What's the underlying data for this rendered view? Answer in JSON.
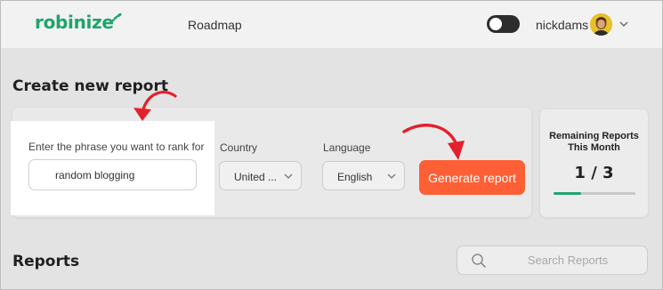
{
  "header": {
    "logo_text": "robinize",
    "nav": {
      "roadmap": "Roadmap"
    },
    "theme_toggle": {
      "state": "off"
    },
    "user": {
      "name": "nickdams"
    }
  },
  "create_report": {
    "title": "Create new report",
    "phrase": {
      "label": "Enter the phrase you want to rank for",
      "value": "random blogging"
    },
    "country": {
      "label": "Country",
      "selected": "United ..."
    },
    "language": {
      "label": "Language",
      "selected": "English"
    },
    "generate_label": "Generate report"
  },
  "remaining": {
    "title": "Remaining Reports This Month",
    "count": "1 / 3",
    "used": 1,
    "total": 3
  },
  "reports": {
    "title": "Reports",
    "search_placeholder": "Search Reports"
  },
  "colors": {
    "brand_green": "#1fa46d",
    "accent_orange": "#ff5f35",
    "annotation_red": "#e3202b"
  },
  "icons": {
    "logo": "leaf-icon",
    "user_menu": "chevron-down-icon",
    "select": "chevron-down-icon",
    "search": "search-icon",
    "annotation": "curved-arrow-icon"
  }
}
